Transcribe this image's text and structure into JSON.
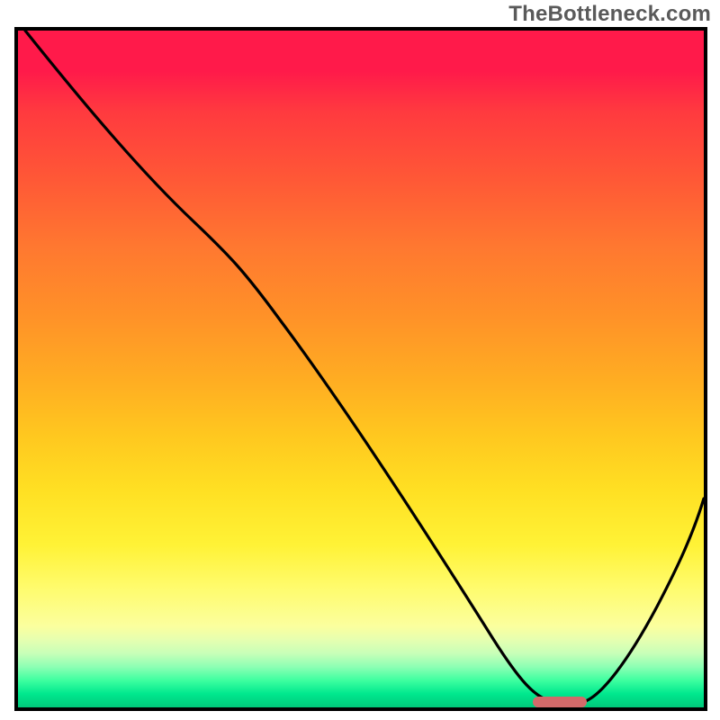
{
  "watermark": "TheBottleneck.com",
  "colors": {
    "border": "#000000",
    "watermark_text": "#5a5a5a",
    "marker": "#d36a6a",
    "gradient_top": "#ff1a4a",
    "gradient_bottom": "#00c87a"
  },
  "chart_data": {
    "type": "line",
    "title": "",
    "xlabel": "",
    "ylabel": "",
    "xlim": [
      0,
      100
    ],
    "ylim": [
      0,
      100
    ],
    "grid": false,
    "legend": false,
    "background": "vertical-gradient red→yellow→green",
    "x": [
      0,
      20,
      30,
      42,
      55,
      65,
      74,
      78,
      82,
      90,
      100
    ],
    "values": [
      100,
      78,
      70,
      55,
      37,
      22,
      7,
      1,
      1,
      12,
      32
    ],
    "marker": {
      "x_range": [
        76,
        84
      ],
      "y": 0.5,
      "color": "#d36a6a"
    },
    "notes": "Values read from vertical position relative to chart height; x axis unlabeled, treated as 0-100. Curve descends steeply from top-left, reaches near-zero around x≈78-82 (marked by short red bar on baseline), then rises toward x=100."
  }
}
